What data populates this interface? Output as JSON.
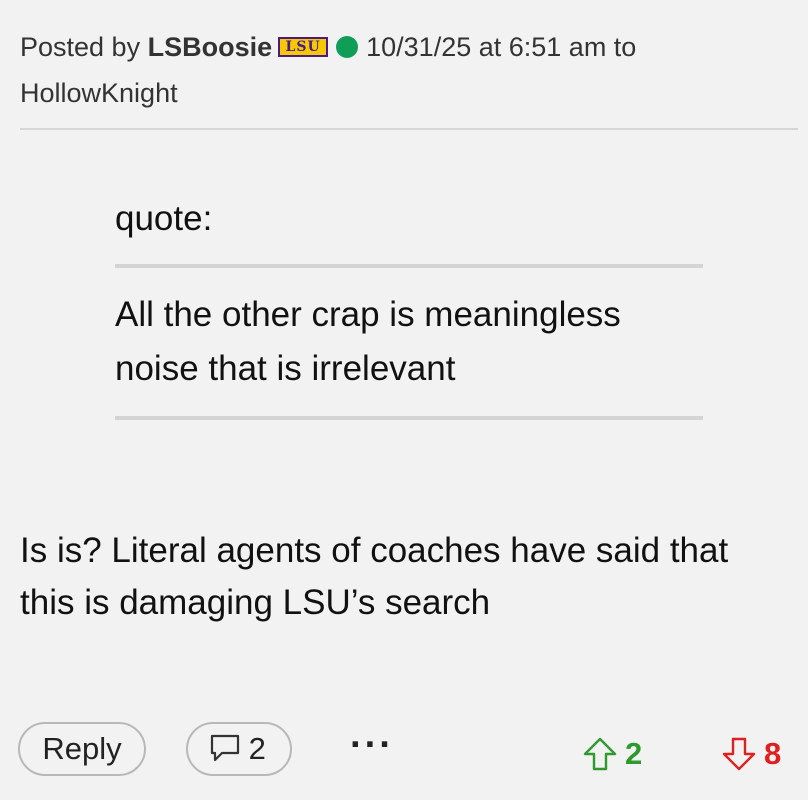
{
  "post": {
    "posted_by_prefix": "Posted by",
    "username": "LSBoosie",
    "team_logo_text": "LSU",
    "timestamp": "10/31/25 at 6:51 am to",
    "reply_to": "HollowKnight"
  },
  "quote": {
    "label": "quote:",
    "text": "All the other crap is meaningless noise that is irrelevant"
  },
  "body": {
    "text": "Is is? Literal agents of coaches have said that this is damaging LSU’s search"
  },
  "actions": {
    "reply_label": "Reply",
    "comment_count": "2",
    "more_label": "···",
    "upvotes": "2",
    "downvotes": "8"
  },
  "colors": {
    "online": "#0f9d58",
    "upvote": "#2e9a2e",
    "downvote": "#e02020",
    "lsu_gold": "#f6c800",
    "lsu_purple": "#4a1a8a"
  },
  "icons": {
    "online_status": "online-dot-icon",
    "comment": "speech-bubble-icon",
    "upvote": "arrow-up-icon",
    "downvote": "arrow-down-icon"
  }
}
